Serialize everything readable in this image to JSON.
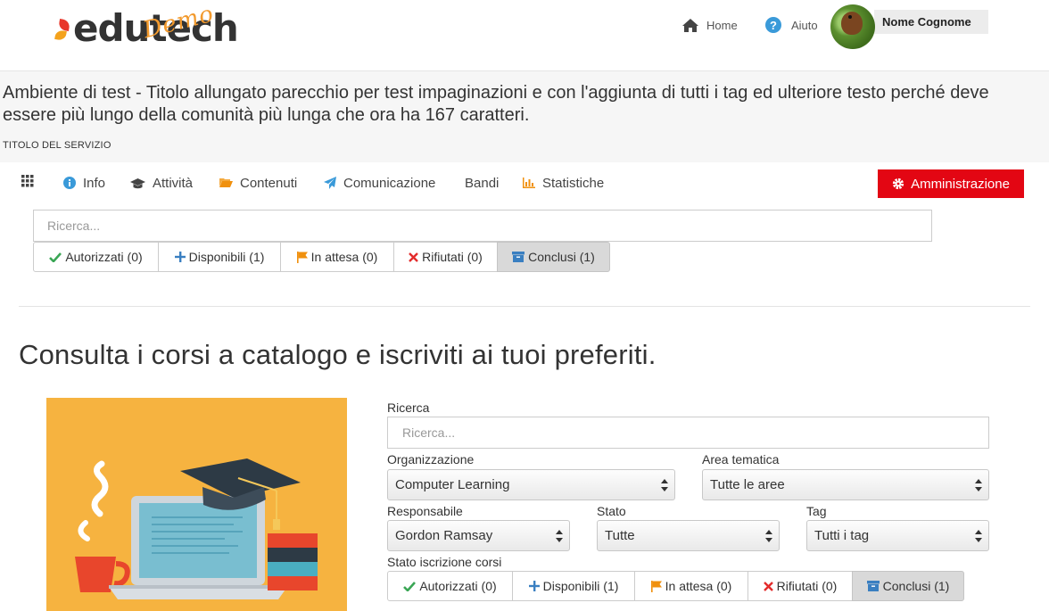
{
  "header": {
    "logo_text": "edutech",
    "logo_badge": "Demo",
    "nav": {
      "home": "Home",
      "help": "Aiuto",
      "help_icon": "?"
    },
    "user_name": "Nome Cognome"
  },
  "community": {
    "title": "Ambiente di test - Titolo allungato parecchio per test impaginazioni e con l'aggiunta di tutti i tag ed ulteriore testo perché deve essere più lungo della comunità più lunga che ora ha 167 caratteri.",
    "service_title": "TITOLO DEL SERVIZIO"
  },
  "service_nav": {
    "items": [
      {
        "label": "Info",
        "icon": "info-icon"
      },
      {
        "label": "Attività",
        "icon": "graduation-cap-icon"
      },
      {
        "label": "Contenuti",
        "icon": "folder-icon"
      },
      {
        "label": "Comunicazione",
        "icon": "paper-plane-icon"
      },
      {
        "label": "Bandi",
        "icon": ""
      },
      {
        "label": "Statistiche",
        "icon": "bar-chart-icon"
      }
    ],
    "admin_label": "Amministrazione"
  },
  "top_search": {
    "placeholder": "Ricerca..."
  },
  "status_filters": [
    {
      "label": "Autorizzati (0)",
      "icon": "check-icon",
      "active": false
    },
    {
      "label": "Disponibili (1)",
      "icon": "plus-icon",
      "active": false
    },
    {
      "label": "In attesa (0)",
      "icon": "flag-icon",
      "active": false
    },
    {
      "label": "Rifiutati (0)",
      "icon": "cross-icon",
      "active": false
    },
    {
      "label": "Conclusi (1)",
      "icon": "archive-icon",
      "active": true
    }
  ],
  "catalog": {
    "heading": "Consulta i corsi a catalogo e iscriviti ai tuoi preferiti.",
    "search_label": "Ricerca",
    "search_placeholder": "Ricerca...",
    "organizzazione_label": "Organizzazione",
    "organizzazione_value": "Computer Learning",
    "area_label": "Area tematica",
    "area_value": "Tutte le aree",
    "responsabile_label": "Responsabile",
    "responsabile_value": "Gordon Ramsay",
    "stato_label": "Stato",
    "stato_value": "Tutte",
    "tag_label": "Tag",
    "tag_value": "Tutti i tag",
    "stato_iscrizione_label": "Stato iscrizione corsi"
  },
  "colors": {
    "accent_red": "#e30613",
    "check_green": "#3aa655",
    "plus_blue": "#3a7fc1",
    "flag_orange": "#f0900d",
    "cross_red": "#e32b2b",
    "archive_blue": "#3a7fc1",
    "illustration_bg": "#f6b340"
  }
}
